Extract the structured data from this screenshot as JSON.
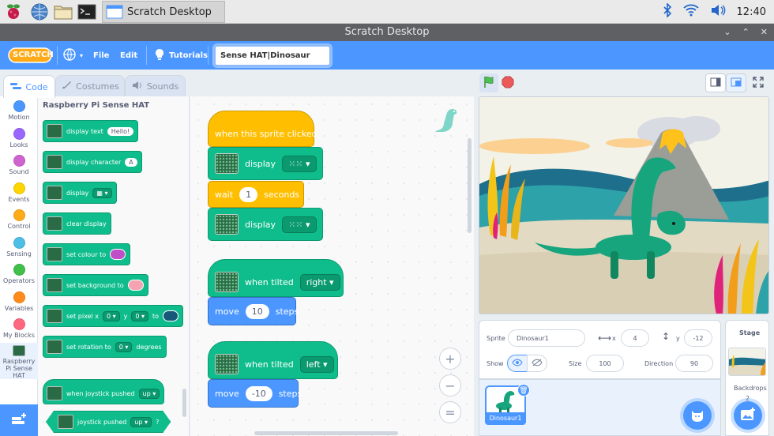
{
  "taskbar": {
    "window_title": "Scratch Desktop",
    "clock": "12:40",
    "icons": [
      "raspberry-icon",
      "globe-icon",
      "folder-icon",
      "terminal-icon"
    ]
  },
  "titlebar": {
    "title": "Scratch Desktop"
  },
  "menubar": {
    "logo": "SCRATCH",
    "file": "File",
    "edit": "Edit",
    "tutorials": "Tutorials",
    "project_title": "Sense HAT|Dinosaur"
  },
  "tabs": {
    "code": "Code",
    "costumes": "Costumes",
    "sounds": "Sounds"
  },
  "categories": [
    {
      "label": "Motion",
      "color": "#4c97ff"
    },
    {
      "label": "Looks",
      "color": "#9966ff"
    },
    {
      "label": "Sound",
      "color": "#cf63cf"
    },
    {
      "label": "Events",
      "color": "#ffd500"
    },
    {
      "label": "Control",
      "color": "#ffab19"
    },
    {
      "label": "Sensing",
      "color": "#4cbfe6"
    },
    {
      "label": "Operators",
      "color": "#40bf4a"
    },
    {
      "label": "Variables",
      "color": "#ff8c1a"
    },
    {
      "label": "My Blocks",
      "color": "#ff6680"
    },
    {
      "label": "Raspberry Pi Sense HAT",
      "color": "#0fbd8c"
    }
  ],
  "palette": {
    "heading": "Raspberry Pi Sense HAT",
    "display_text": "display text",
    "display_text_value": "Hello!",
    "display_character": "display character",
    "display_character_value": "A",
    "display": "display",
    "clear_display": "clear display",
    "set_colour": "set colour to",
    "set_colour_color": "#c04fc7",
    "set_background": "set background to",
    "set_background_color": "#f5a3b0",
    "set_pixel": "set pixel x",
    "set_pixel_x": "0",
    "set_pixel_y_label": "y",
    "set_pixel_y": "0",
    "set_pixel_to": "to",
    "set_pixel_color": "#17577a",
    "set_rotation": "set rotation to",
    "set_rotation_value": "0",
    "set_rotation_unit": "degrees",
    "joystick_pushed_hat": "when joystick pushed",
    "joystick_pushed_hat_value": "up",
    "joystick_pushed_bool": "joystick pushed",
    "joystick_pushed_bool_value": "up",
    "joystick_pushed_bool_q": "?"
  },
  "scripts": {
    "s1_hat": "when this sprite clicked",
    "s1_display1": "display",
    "s1_wait": "wait",
    "s1_wait_value": "1",
    "s1_wait_unit": "seconds",
    "s1_display2": "display",
    "s2_hat": "when tilted",
    "s2_hat_value": "right",
    "s2_move": "move",
    "s2_move_value": "10",
    "s2_move_unit": "steps",
    "s3_hat": "when tilted",
    "s3_hat_value": "left",
    "s3_move": "move",
    "s3_move_value": "-10",
    "s3_move_unit": "steps"
  },
  "zoom": {
    "in": "+",
    "out": "−",
    "reset": "="
  },
  "sprite_info": {
    "sprite_label": "Sprite",
    "sprite_name": "Dinosaur1",
    "x_label": "x",
    "x_value": "4",
    "y_label": "y",
    "y_value": "-12",
    "show_label": "Show",
    "size_label": "Size",
    "size_value": "100",
    "direction_label": "Direction",
    "direction_value": "90"
  },
  "sprite_list": {
    "sprite_name": "Dinosaur1"
  },
  "stage_panel": {
    "title": "Stage",
    "backdrops_label": "Backdrops",
    "backdrops_count": "2"
  },
  "colors": {
    "accent": "#4c97ff",
    "sensehat": "#0fbd8c",
    "events": "#ffbf00",
    "motion": "#4c97ff"
  }
}
